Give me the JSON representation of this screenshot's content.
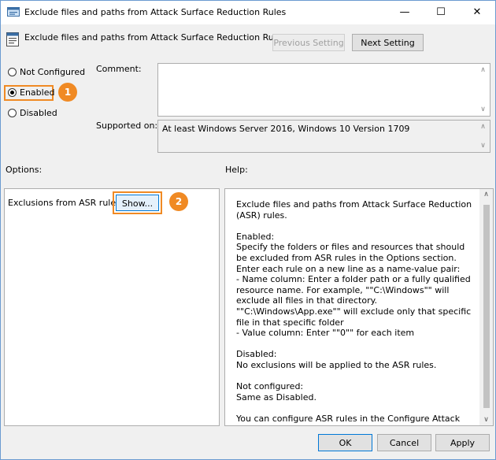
{
  "window": {
    "title": "Exclude files and paths from Attack Surface Reduction Rules",
    "minimize_glyph": "—",
    "maximize_glyph": "☐",
    "close_glyph": "✕"
  },
  "header": {
    "title": "Exclude files and paths from Attack Surface Reduction Rules",
    "prev_label": "Previous Setting",
    "next_label": "Next Setting"
  },
  "state": {
    "options": [
      "Not Configured",
      "Enabled",
      "Disabled"
    ],
    "selected": "Enabled"
  },
  "comment_label": "Comment:",
  "supported": {
    "label": "Supported on:",
    "value": "At least Windows Server 2016, Windows 10 Version 1709"
  },
  "options_label": "Options:",
  "help_label": "Help:",
  "option_row": {
    "label": "Exclusions from ASR rules:",
    "show_label": "Show..."
  },
  "callouts": [
    "1",
    "2"
  ],
  "help_text": "Exclude files and paths from Attack Surface Reduction (ASR) rules.\n\nEnabled:\nSpecify the folders or files and resources that should be excluded from ASR rules in the Options section.\nEnter each rule on a new line as a name-value pair:\n- Name column: Enter a folder path or a fully qualified resource name. For example, \"\"C:\\Windows\"\" will exclude all files in that directory. \"\"C:\\Windows\\App.exe\"\" will exclude only that specific file in that specific folder\n- Value column: Enter \"\"0\"\" for each item\n\nDisabled:\nNo exclusions will be applied to the ASR rules.\n\nNot configured:\nSame as Disabled.\n\nYou can configure ASR rules in the Configure Attack Surface Reduction rules GP setting.",
  "footer": {
    "ok": "OK",
    "cancel": "Cancel",
    "apply": "Apply"
  },
  "colors": {
    "accent": "#f08a24",
    "window_bg": "#f0f0f0"
  },
  "icons": [
    "policy-icon",
    "radio-button",
    "scroll-up-icon",
    "scroll-down-icon"
  ]
}
